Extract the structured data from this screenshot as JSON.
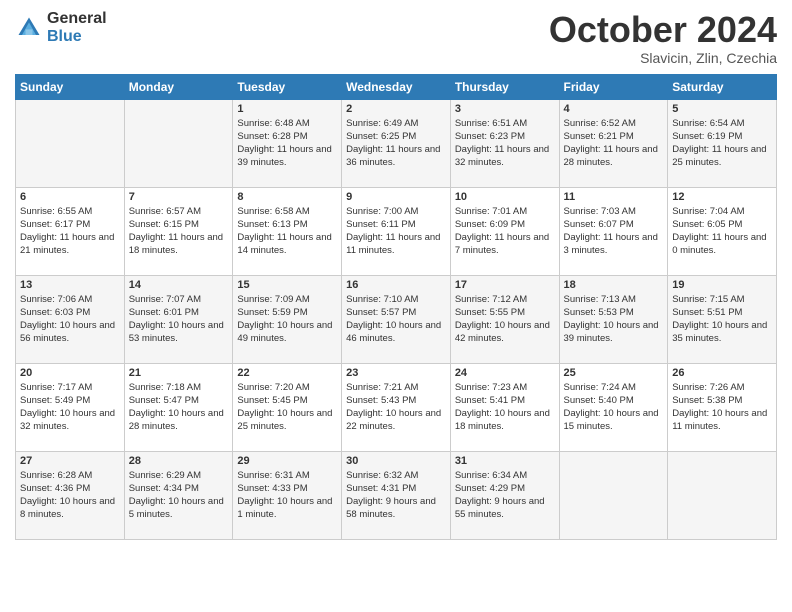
{
  "logo": {
    "line1": "General",
    "line2": "Blue"
  },
  "title": "October 2024",
  "subtitle": "Slavicin, Zlin, Czechia",
  "days_of_week": [
    "Sunday",
    "Monday",
    "Tuesday",
    "Wednesday",
    "Thursday",
    "Friday",
    "Saturday"
  ],
  "weeks": [
    [
      {
        "day": "",
        "info": ""
      },
      {
        "day": "",
        "info": ""
      },
      {
        "day": "1",
        "info": "Sunrise: 6:48 AM\nSunset: 6:28 PM\nDaylight: 11 hours and 39 minutes."
      },
      {
        "day": "2",
        "info": "Sunrise: 6:49 AM\nSunset: 6:25 PM\nDaylight: 11 hours and 36 minutes."
      },
      {
        "day": "3",
        "info": "Sunrise: 6:51 AM\nSunset: 6:23 PM\nDaylight: 11 hours and 32 minutes."
      },
      {
        "day": "4",
        "info": "Sunrise: 6:52 AM\nSunset: 6:21 PM\nDaylight: 11 hours and 28 minutes."
      },
      {
        "day": "5",
        "info": "Sunrise: 6:54 AM\nSunset: 6:19 PM\nDaylight: 11 hours and 25 minutes."
      }
    ],
    [
      {
        "day": "6",
        "info": "Sunrise: 6:55 AM\nSunset: 6:17 PM\nDaylight: 11 hours and 21 minutes."
      },
      {
        "day": "7",
        "info": "Sunrise: 6:57 AM\nSunset: 6:15 PM\nDaylight: 11 hours and 18 minutes."
      },
      {
        "day": "8",
        "info": "Sunrise: 6:58 AM\nSunset: 6:13 PM\nDaylight: 11 hours and 14 minutes."
      },
      {
        "day": "9",
        "info": "Sunrise: 7:00 AM\nSunset: 6:11 PM\nDaylight: 11 hours and 11 minutes."
      },
      {
        "day": "10",
        "info": "Sunrise: 7:01 AM\nSunset: 6:09 PM\nDaylight: 11 hours and 7 minutes."
      },
      {
        "day": "11",
        "info": "Sunrise: 7:03 AM\nSunset: 6:07 PM\nDaylight: 11 hours and 3 minutes."
      },
      {
        "day": "12",
        "info": "Sunrise: 7:04 AM\nSunset: 6:05 PM\nDaylight: 11 hours and 0 minutes."
      }
    ],
    [
      {
        "day": "13",
        "info": "Sunrise: 7:06 AM\nSunset: 6:03 PM\nDaylight: 10 hours and 56 minutes."
      },
      {
        "day": "14",
        "info": "Sunrise: 7:07 AM\nSunset: 6:01 PM\nDaylight: 10 hours and 53 minutes."
      },
      {
        "day": "15",
        "info": "Sunrise: 7:09 AM\nSunset: 5:59 PM\nDaylight: 10 hours and 49 minutes."
      },
      {
        "day": "16",
        "info": "Sunrise: 7:10 AM\nSunset: 5:57 PM\nDaylight: 10 hours and 46 minutes."
      },
      {
        "day": "17",
        "info": "Sunrise: 7:12 AM\nSunset: 5:55 PM\nDaylight: 10 hours and 42 minutes."
      },
      {
        "day": "18",
        "info": "Sunrise: 7:13 AM\nSunset: 5:53 PM\nDaylight: 10 hours and 39 minutes."
      },
      {
        "day": "19",
        "info": "Sunrise: 7:15 AM\nSunset: 5:51 PM\nDaylight: 10 hours and 35 minutes."
      }
    ],
    [
      {
        "day": "20",
        "info": "Sunrise: 7:17 AM\nSunset: 5:49 PM\nDaylight: 10 hours and 32 minutes."
      },
      {
        "day": "21",
        "info": "Sunrise: 7:18 AM\nSunset: 5:47 PM\nDaylight: 10 hours and 28 minutes."
      },
      {
        "day": "22",
        "info": "Sunrise: 7:20 AM\nSunset: 5:45 PM\nDaylight: 10 hours and 25 minutes."
      },
      {
        "day": "23",
        "info": "Sunrise: 7:21 AM\nSunset: 5:43 PM\nDaylight: 10 hours and 22 minutes."
      },
      {
        "day": "24",
        "info": "Sunrise: 7:23 AM\nSunset: 5:41 PM\nDaylight: 10 hours and 18 minutes."
      },
      {
        "day": "25",
        "info": "Sunrise: 7:24 AM\nSunset: 5:40 PM\nDaylight: 10 hours and 15 minutes."
      },
      {
        "day": "26",
        "info": "Sunrise: 7:26 AM\nSunset: 5:38 PM\nDaylight: 10 hours and 11 minutes."
      }
    ],
    [
      {
        "day": "27",
        "info": "Sunrise: 6:28 AM\nSunset: 4:36 PM\nDaylight: 10 hours and 8 minutes."
      },
      {
        "day": "28",
        "info": "Sunrise: 6:29 AM\nSunset: 4:34 PM\nDaylight: 10 hours and 5 minutes."
      },
      {
        "day": "29",
        "info": "Sunrise: 6:31 AM\nSunset: 4:33 PM\nDaylight: 10 hours and 1 minute."
      },
      {
        "day": "30",
        "info": "Sunrise: 6:32 AM\nSunset: 4:31 PM\nDaylight: 9 hours and 58 minutes."
      },
      {
        "day": "31",
        "info": "Sunrise: 6:34 AM\nSunset: 4:29 PM\nDaylight: 9 hours and 55 minutes."
      },
      {
        "day": "",
        "info": ""
      },
      {
        "day": "",
        "info": ""
      }
    ]
  ]
}
